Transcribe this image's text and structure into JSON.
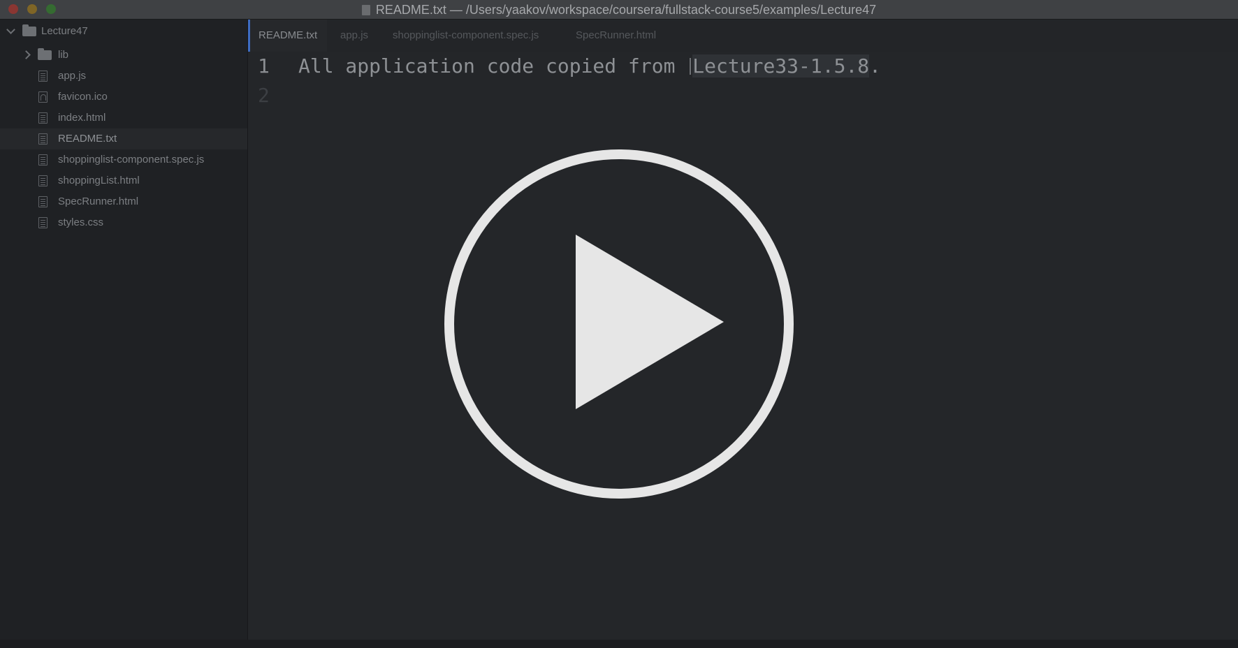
{
  "window": {
    "title": "README.txt — /Users/yaakov/workspace/coursera/fullstack-course5/examples/Lecture47"
  },
  "sidebar": {
    "root": {
      "label": "Lecture47",
      "icon": "folder-icon"
    },
    "items": [
      {
        "label": "lib",
        "icon": "folder-icon"
      },
      {
        "label": "app.js",
        "icon": "file-icon"
      },
      {
        "label": "favicon.ico",
        "icon": "ico-file-icon"
      },
      {
        "label": "index.html",
        "icon": "file-icon"
      },
      {
        "label": "README.txt",
        "icon": "file-icon",
        "selected": true
      },
      {
        "label": "shoppinglist-component.spec.js",
        "icon": "file-icon"
      },
      {
        "label": "shoppingList.html",
        "icon": "file-icon"
      },
      {
        "label": "SpecRunner.html",
        "icon": "file-icon"
      },
      {
        "label": "styles.css",
        "icon": "file-icon"
      }
    ]
  },
  "tabs": [
    {
      "label": "README.txt",
      "active": true
    },
    {
      "label": "app.js"
    },
    {
      "label": "shoppinglist-component.spec.js"
    },
    {
      "label": "SpecRunner.html"
    }
  ],
  "editor": {
    "lines": [
      {
        "number": "1",
        "text_before": "All application code copied from ",
        "text_highlight": "Lecture33-1.5.8",
        "text_after": "."
      },
      {
        "number": "2",
        "text": ""
      }
    ]
  },
  "overlay": {
    "icon": "play-icon",
    "color": "#e6e6e6"
  },
  "colors": {
    "background": "#222427",
    "active_tab_accent": "#3d6cc2"
  }
}
